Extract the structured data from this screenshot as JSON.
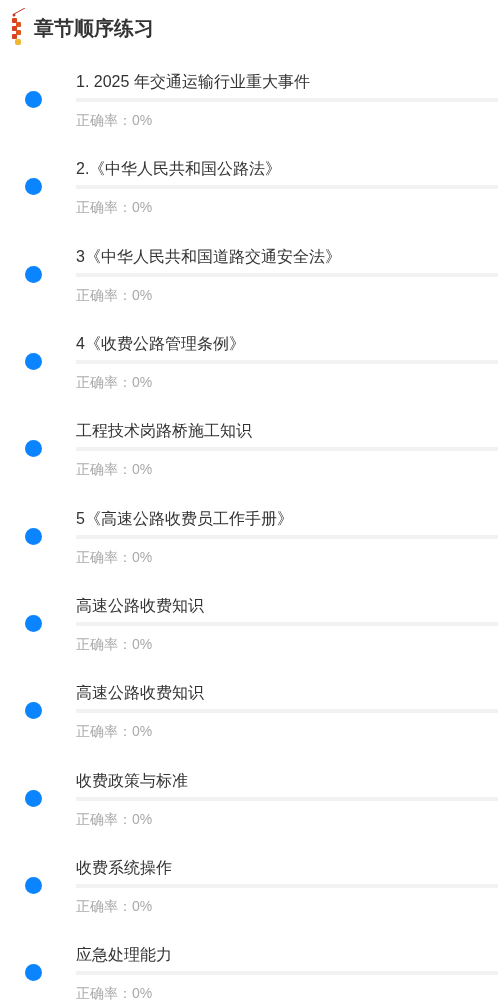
{
  "header": {
    "title": "章节顺序练习"
  },
  "chapters": [
    {
      "title": "1. 2025 年交通运输行业重大事件",
      "level": 0,
      "accuracy": "正确率：0%"
    },
    {
      "title": "2.《中华人民共和国公路法》",
      "level": 0,
      "accuracy": "正确率：0%"
    },
    {
      "title": "3《中华人民共和国道路交通安全法》",
      "level": 0,
      "accuracy": "正确率：0%"
    },
    {
      "title": "4《收费公路管理条例》",
      "level": 0,
      "accuracy": "正确率：0%"
    },
    {
      "title": "工程技术岗路桥施工知识",
      "level": 0,
      "accuracy": "正确率：0%"
    },
    {
      "title": "5《高速公路收费员工作手册》",
      "level": 0,
      "accuracy": "正确率：0%"
    },
    {
      "title": "高速公路收费知识",
      "level": 0,
      "accuracy": "正确率：0%"
    },
    {
      "title": "高速公路收费知识",
      "level": 0,
      "accuracy": "正确率：0%"
    },
    {
      "title": "收费政策与标准",
      "level": 0,
      "accuracy": "正确率：0%"
    },
    {
      "title": "收费系统操作",
      "level": 0,
      "accuracy": "正确率：0%"
    },
    {
      "title": "应急处理能力",
      "level": 0,
      "accuracy": "正确率：0%"
    }
  ]
}
